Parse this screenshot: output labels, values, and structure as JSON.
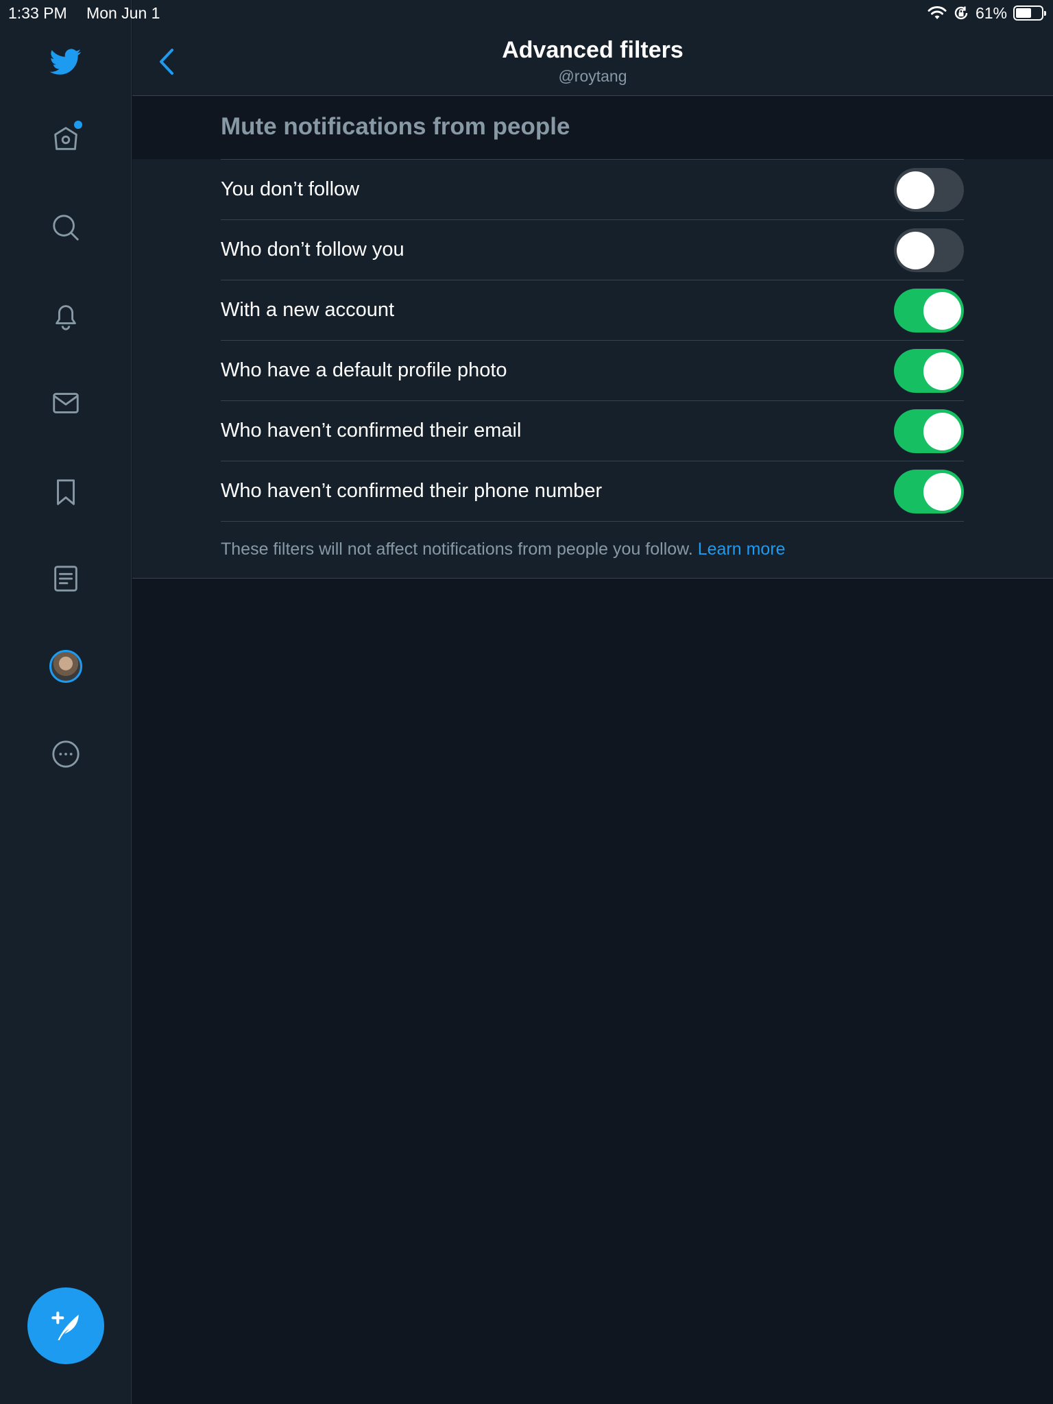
{
  "status_bar": {
    "time": "1:33 PM",
    "date": "Mon Jun 1",
    "battery_text": "61%",
    "battery_level": 0.61,
    "icons": [
      "wifi-icon",
      "rotation-lock-icon",
      "battery-icon"
    ]
  },
  "sidebar": {
    "items": [
      {
        "name": "twitter-logo-icon",
        "icon": "bird"
      },
      {
        "name": "home-icon",
        "icon": "home",
        "has_notification_dot": true
      },
      {
        "name": "search-icon",
        "icon": "magnifier"
      },
      {
        "name": "notifications-icon",
        "icon": "bell"
      },
      {
        "name": "messages-icon",
        "icon": "envelope"
      },
      {
        "name": "bookmarks-icon",
        "icon": "bookmark"
      },
      {
        "name": "lists-icon",
        "icon": "list"
      },
      {
        "name": "profile-avatar",
        "icon": "avatar"
      },
      {
        "name": "more-icon",
        "icon": "ellipsis-circle"
      }
    ],
    "compose_icon": "compose-feather-icon"
  },
  "header": {
    "title": "Advanced filters",
    "subtitle": "@roytang"
  },
  "section": {
    "heading": "Mute notifications from people"
  },
  "filters": [
    {
      "label": "You don’t follow",
      "on": false
    },
    {
      "label": "Who don’t follow you",
      "on": false
    },
    {
      "label": "With a new account",
      "on": true
    },
    {
      "label": "Who have a default profile photo",
      "on": true
    },
    {
      "label": "Who haven’t confirmed their email",
      "on": true
    },
    {
      "label": "Who haven’t confirmed their phone number",
      "on": true
    }
  ],
  "footer": {
    "note": "These filters will not affect notifications from people you follow.",
    "link": "Learn more"
  },
  "colors": {
    "accent": "#1d9bf0",
    "toggle_on": "#17bf63",
    "toggle_off": "#3a424c",
    "background": "#10161f",
    "surface": "#15202b",
    "muted_text": "#8899a6"
  }
}
